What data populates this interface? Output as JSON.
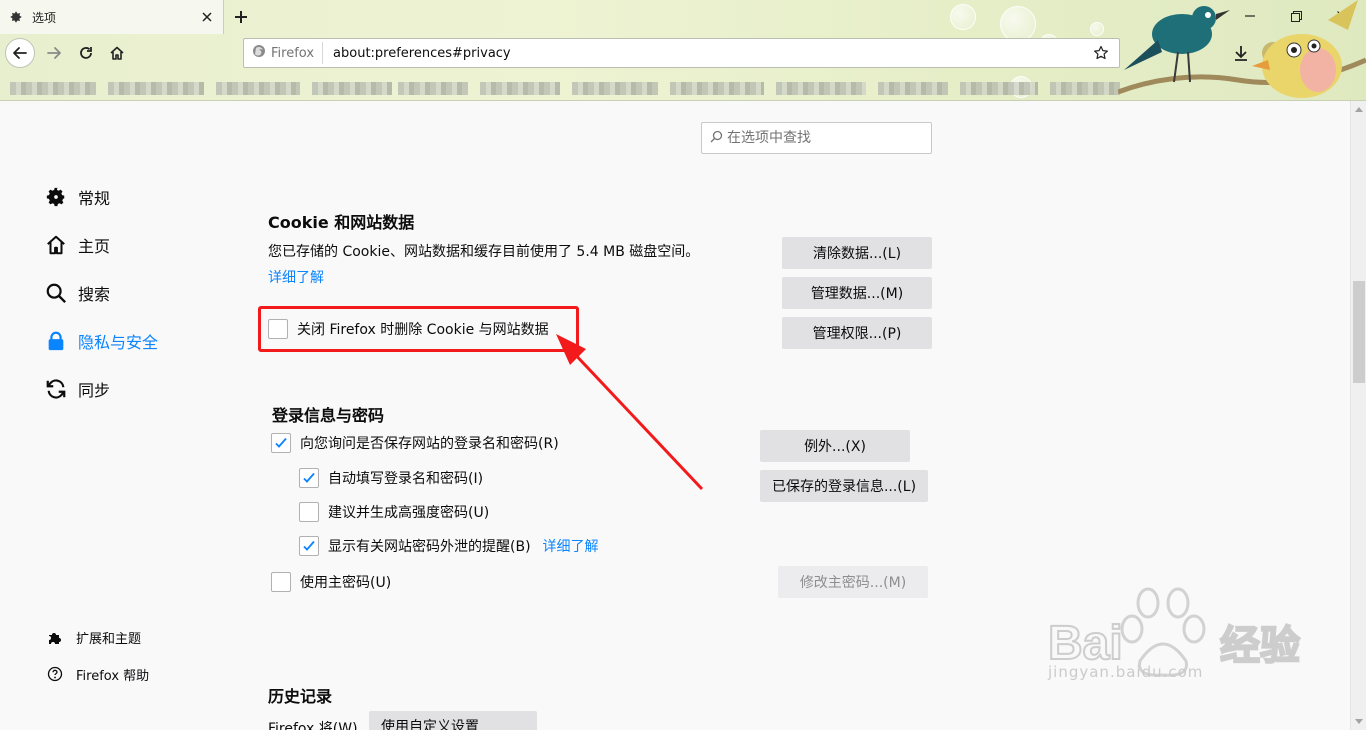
{
  "tab": {
    "title": "选项"
  },
  "navbar": {
    "identity_label": "Firefox",
    "url": "about:preferences#privacy"
  },
  "search": {
    "placeholder": "在选项中查找"
  },
  "sidebar": {
    "categories": [
      {
        "label": "常规",
        "icon": "gear-icon"
      },
      {
        "label": "主页",
        "icon": "home-icon"
      },
      {
        "label": "搜索",
        "icon": "search-icon"
      },
      {
        "label": "隐私与安全",
        "icon": "lock-icon",
        "selected": true
      },
      {
        "label": "同步",
        "icon": "sync-icon"
      }
    ],
    "footer": [
      {
        "label": "扩展和主题",
        "icon": "puzzle-icon"
      },
      {
        "label": "Firefox 帮助",
        "icon": "help-icon"
      }
    ]
  },
  "cookies": {
    "title": "Cookie 和网站数据",
    "description": "您已存储的 Cookie、网站数据和缓存目前使用了 5.4 MB 磁盘空间。",
    "learn_more": "详细了解",
    "delete_on_close": {
      "label": "关闭 Firefox 时删除 Cookie 与网站数据",
      "checked": false
    },
    "clear_data_button": "清除数据...(L)",
    "manage_data_button": "管理数据...(M)",
    "manage_permissions_button": "管理权限...(P)"
  },
  "logins": {
    "title": "登录信息与密码",
    "ask_to_save": {
      "label": "向您询问是否保存网站的登录名和密码(R)",
      "checked": true
    },
    "autofill": {
      "label": "自动填写登录名和密码(I)",
      "checked": true
    },
    "suggest_passwords": {
      "label": "建议并生成高强度密码(U)",
      "checked": false
    },
    "breach_alerts": {
      "label": "显示有关网站密码外泄的提醒(B)",
      "checked": true,
      "learn_more": "详细了解"
    },
    "master_password": {
      "label": "使用主密码(U)",
      "checked": false
    },
    "exceptions_button": "例外...(X)",
    "saved_logins_button": "已保存的登录信息...(L)",
    "change_master_button": "修改主密码...(M)"
  },
  "history": {
    "title": "历史记录",
    "mode_label": "Firefox 将(W)",
    "mode_value": "使用自定义设置"
  },
  "watermark": {
    "text": "jingyan.baidu.com"
  },
  "colors": {
    "accent": "#0a84ff",
    "highlight": "#f21a1a"
  }
}
